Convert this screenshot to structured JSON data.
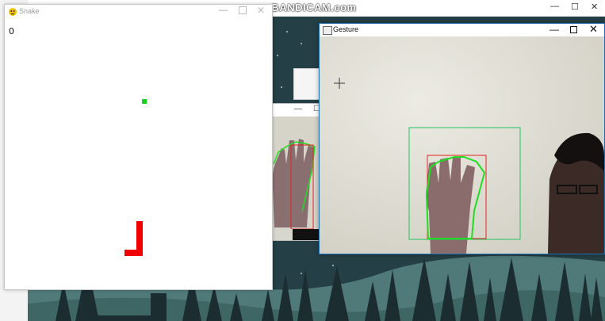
{
  "watermark": "www.BANDICAM.com",
  "background_windows": {
    "top_window_controls": [
      "—",
      "☐",
      "✕"
    ],
    "camera_window_2_controls": [
      "—",
      "☐"
    ]
  },
  "snake_window": {
    "title": "Snake",
    "controls": {
      "minimize": "—",
      "close": "✕"
    },
    "score": "0",
    "colors": {
      "background": "#ffffff",
      "snake": "#f00000",
      "food": "#17d11e"
    }
  },
  "gesture_window": {
    "title": "Gesture",
    "controls": {
      "minimize": "—",
      "close": "✕"
    },
    "colors": {
      "outer_box": "#22c55e",
      "inner_box": "#e02424",
      "hand_contour": "#22dd22"
    }
  },
  "icons": [
    "snake-app-icon",
    "window-app-icon",
    "minimize-icon",
    "maximize-icon",
    "close-icon",
    "crosshair-cursor-icon"
  ]
}
